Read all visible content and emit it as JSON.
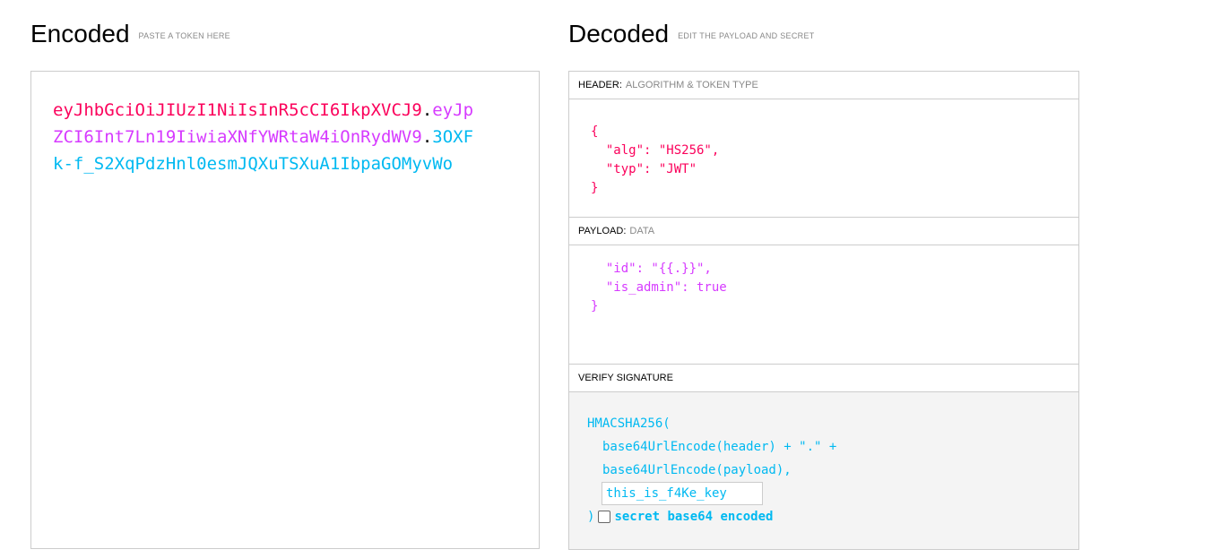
{
  "encoded": {
    "title": "Encoded",
    "subtitle": "PASTE A TOKEN HERE",
    "token": {
      "header": "eyJhbGciOiJIUzI1NiIsInR5cCI6IkpXVCJ9",
      "payload": "eyJpZCI6Int7Ln19IiwiaXNfYWRtaW4iOnRydWV9",
      "signature": "3OXFk-f_S2XqPdzHnl0esmJQXuTSXuA1IbpaGOMyvWo",
      "separator": "."
    }
  },
  "decoded": {
    "title": "Decoded",
    "subtitle": "EDIT THE PAYLOAD AND SECRET",
    "header": {
      "label": "HEADER:",
      "sublabel": "ALGORITHM & TOKEN TYPE",
      "lines": [
        "{",
        "  \"alg\": \"HS256\",",
        "  \"typ\": \"JWT\"",
        "}"
      ]
    },
    "payload": {
      "label": "PAYLOAD:",
      "sublabel": "DATA",
      "lines": [
        "  \"id\": \"{{.}}\",",
        "  \"is_admin\": true",
        "}"
      ]
    },
    "signature": {
      "label": "VERIFY SIGNATURE",
      "line1": "HMACSHA256(",
      "line2": "base64UrlEncode(header) + \".\" +",
      "line3": "base64UrlEncode(payload),",
      "secret": "this_is_f4Ke_key",
      "close": ")",
      "checkbox_label": "secret base64 encoded",
      "checkbox_checked": false
    }
  },
  "colors": {
    "header": "#fb015b",
    "payload": "#d63aff",
    "signature": "#00b9f1"
  }
}
